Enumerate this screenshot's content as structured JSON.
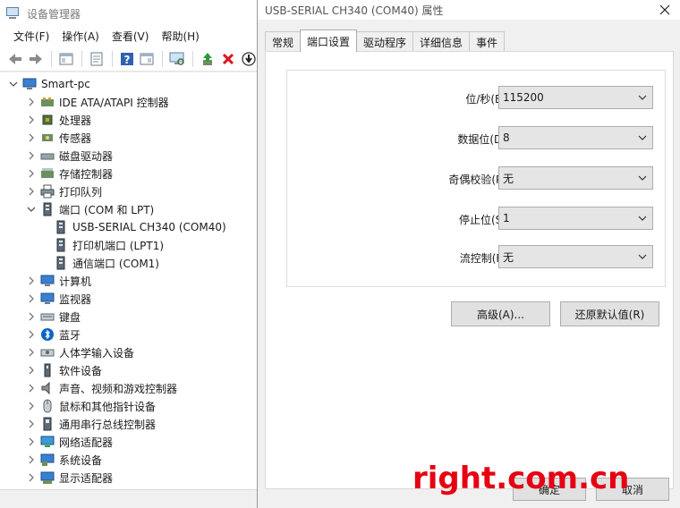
{
  "device_manager": {
    "title": "设备管理器",
    "menu": [
      "文件(F)",
      "操作(A)",
      "查看(V)",
      "帮助(H)"
    ],
    "toolbar_icons": [
      "back-arrow-icon",
      "forward-arrow-icon",
      "show-hide-console-tree-icon",
      "properties-icon",
      "help-icon",
      "action-pane-icon",
      "monitor-scan-icon",
      "update-driver-icon",
      "uninstall-icon",
      "download-icon"
    ],
    "tree": {
      "root": "Smart-pc",
      "categories": [
        {
          "label": "IDE ATA/ATAPI 控制器",
          "icon": "ide-controller-icon"
        },
        {
          "label": "处理器",
          "icon": "processor-icon"
        },
        {
          "label": "传感器",
          "icon": "sensor-icon"
        },
        {
          "label": "磁盘驱动器",
          "icon": "disk-drive-icon"
        },
        {
          "label": "存储控制器",
          "icon": "storage-controller-icon"
        },
        {
          "label": "打印队列",
          "icon": "printer-icon"
        },
        {
          "label": "端口 (COM 和 LPT)",
          "icon": "port-icon",
          "expanded": true,
          "children": [
            "USB-SERIAL CH340 (COM40)",
            "打印机端口 (LPT1)",
            "通信端口 (COM1)"
          ]
        },
        {
          "label": "计算机",
          "icon": "computer-icon"
        },
        {
          "label": "监视器",
          "icon": "monitor-icon"
        },
        {
          "label": "键盘",
          "icon": "keyboard-icon"
        },
        {
          "label": "蓝牙",
          "icon": "bluetooth-icon"
        },
        {
          "label": "人体学输入设备",
          "icon": "hid-icon"
        },
        {
          "label": "软件设备",
          "icon": "software-device-icon"
        },
        {
          "label": "声音、视频和游戏控制器",
          "icon": "speaker-icon"
        },
        {
          "label": "鼠标和其他指针设备",
          "icon": "mouse-icon"
        },
        {
          "label": "通用串行总线控制器",
          "icon": "usb-icon"
        },
        {
          "label": "网络适配器",
          "icon": "network-adapter-icon"
        },
        {
          "label": "系统设备",
          "icon": "system-device-icon"
        },
        {
          "label": "显示适配器",
          "icon": "display-adapter-icon"
        }
      ]
    }
  },
  "properties": {
    "title": "USB-SERIAL CH340 (COM40) 属性",
    "tabs": [
      "常规",
      "端口设置",
      "驱动程序",
      "详细信息",
      "事件"
    ],
    "active_tab": "端口设置",
    "fields": [
      {
        "label": "位/秒(B):",
        "value": "115200"
      },
      {
        "label": "数据位(D):",
        "value": "8"
      },
      {
        "label": "奇偶校验(P):",
        "value": "无"
      },
      {
        "label": "停止位(S):",
        "value": "1"
      },
      {
        "label": "流控制(F):",
        "value": "无"
      }
    ],
    "advanced_button": "高级(A)...",
    "restore_button": "还原默认值(R)",
    "ok_button": "确定",
    "cancel_button": "取消"
  },
  "watermark": "right.com.cn",
  "colors": {
    "accent_red": "#e60012",
    "selected_tab_bg": "#ffffff"
  }
}
